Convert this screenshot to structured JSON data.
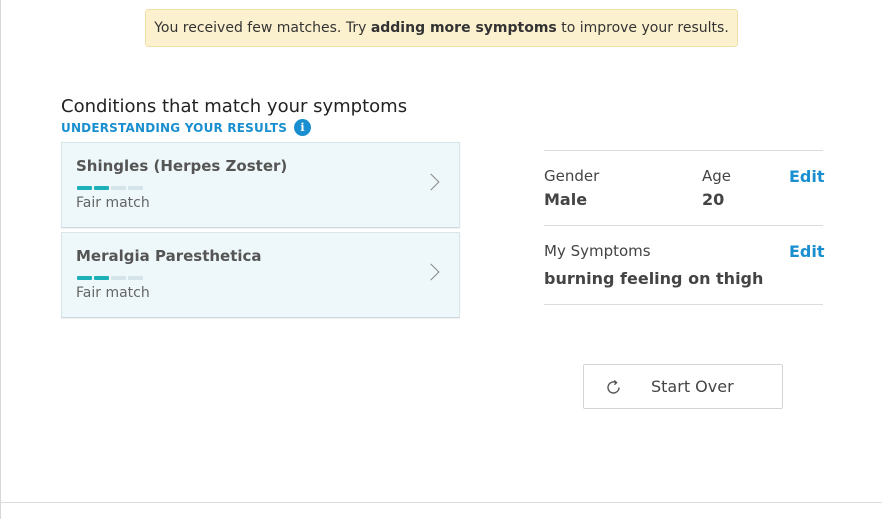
{
  "banner": {
    "prefix": "You received few matches. Try ",
    "bold": "adding more symptoms",
    "suffix": " to improve your results."
  },
  "results": {
    "heading": "Conditions that match your symptoms",
    "understanding_link": "UNDERSTANDING YOUR RESULTS",
    "info_icon_glyph": "i",
    "conditions": [
      {
        "name": "Shingles (Herpes Zoster)",
        "match_label": "Fair match",
        "match_level": 2,
        "match_max": 4
      },
      {
        "name": "Meralgia Paresthetica",
        "match_label": "Fair match",
        "match_level": 2,
        "match_max": 4
      }
    ]
  },
  "profile": {
    "gender_label": "Gender",
    "gender_value": "Male",
    "age_label": "Age",
    "age_value": "20",
    "edit_label": "Edit",
    "symptoms_label": "My Symptoms",
    "symptoms_value": "burning feeling on thigh",
    "symptoms_edit_label": "Edit"
  },
  "actions": {
    "start_over_label": "Start Over",
    "start_over_icon": "refresh-icon"
  },
  "colors": {
    "banner_bg": "#fcf1cf",
    "accent_blue": "#1a8fd0",
    "meter_on": "#1eb0b8",
    "meter_off": "#d4e4e8",
    "card_bg": "#eef8fa"
  }
}
